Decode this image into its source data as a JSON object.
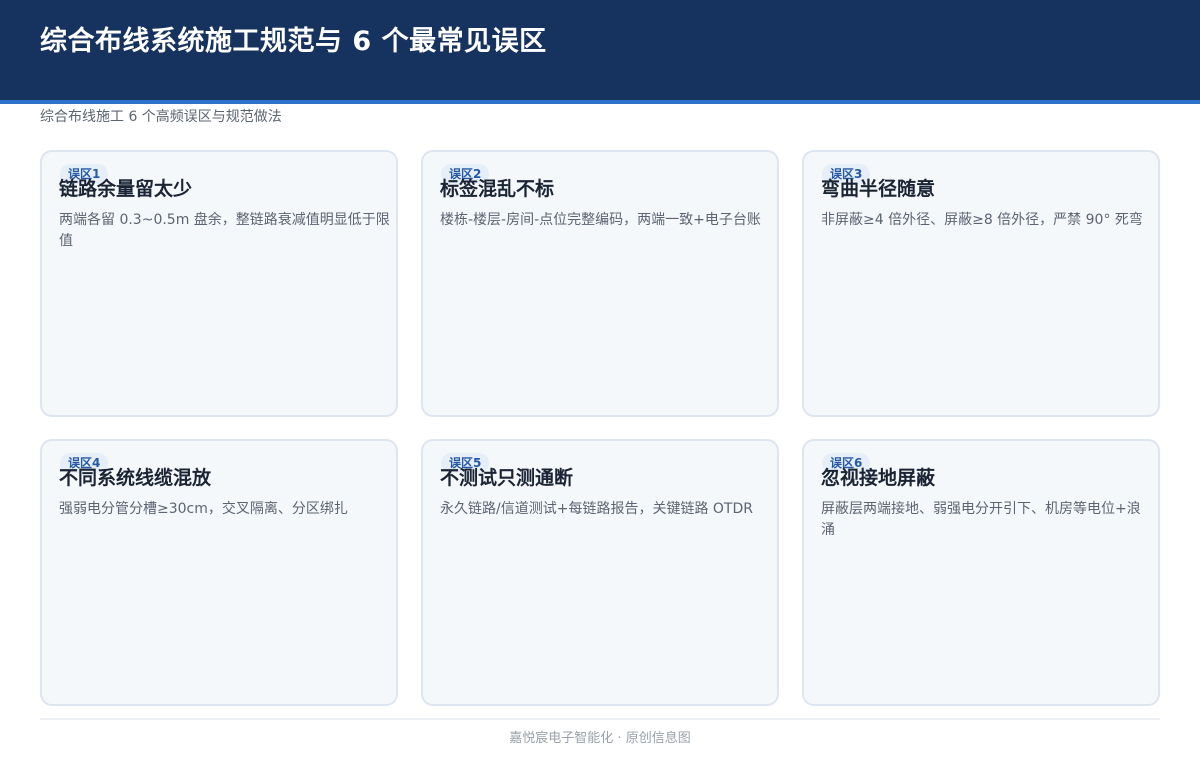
{
  "header": {
    "title": "综合布线系统施工规范与 6 个最常见误区",
    "subtitle": "综合布线施工 6 个高频误区与规范做法"
  },
  "cards": [
    {
      "badge": "误区1",
      "title": "链路余量留太少",
      "desc": "两端各留 0.3~0.5m 盘余，整链路衰减值明显低于限值"
    },
    {
      "badge": "误区2",
      "title": "标签混乱不标",
      "desc": "楼栋-楼层-房间-点位完整编码，两端一致+电子台账"
    },
    {
      "badge": "误区3",
      "title": "弯曲半径随意",
      "desc": "非屏蔽≥4 倍外径、屏蔽≥8 倍外径，严禁 90° 死弯"
    },
    {
      "badge": "误区4",
      "title": "不同系统线缆混放",
      "desc": "强弱电分管分槽≥30cm，交叉隔离、分区绑扎"
    },
    {
      "badge": "误区5",
      "title": "不测试只测通断",
      "desc": "永久链路/信道测试+每链路报告，关键链路 OTDR"
    },
    {
      "badge": "误区6",
      "title": "忽视接地屏蔽",
      "desc": "屏蔽层两端接地、弱强电分开引下、机房等电位+浪涌"
    }
  ],
  "footer": {
    "text": "嘉悦宸电子智能化 · 原创信息图"
  }
}
